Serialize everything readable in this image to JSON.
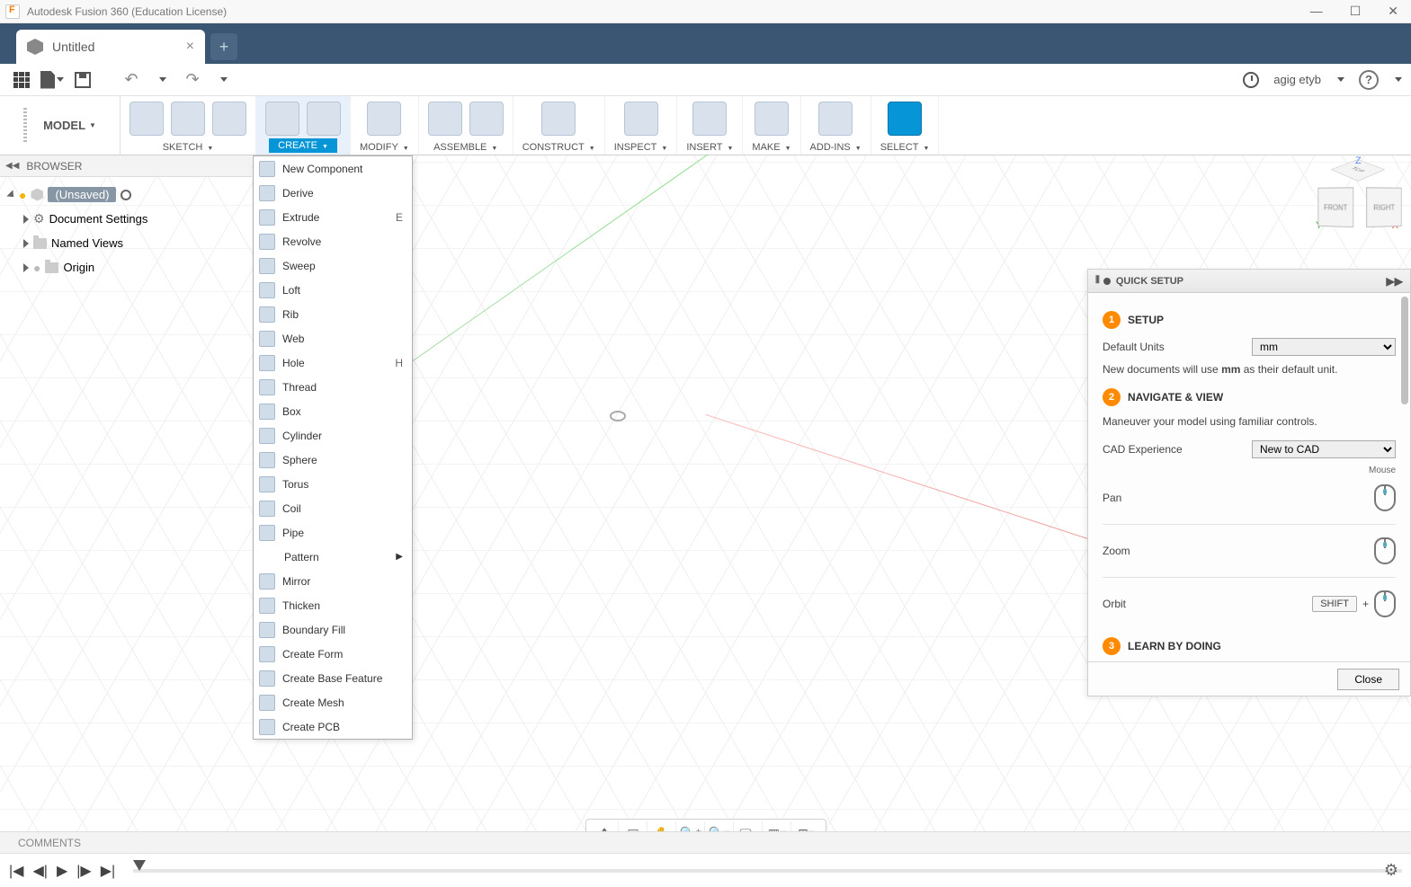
{
  "titlebar": {
    "title": "Autodesk Fusion 360 (Education License)"
  },
  "tab": {
    "name": "Untitled"
  },
  "qat": {
    "user": "agig etyb"
  },
  "workspace": {
    "label": "MODEL"
  },
  "ribbon": [
    {
      "label": "SKETCH",
      "icons": 3
    },
    {
      "label": "CREATE",
      "icons": 2,
      "active": true
    },
    {
      "label": "MODIFY",
      "icons": 1
    },
    {
      "label": "ASSEMBLE",
      "icons": 2
    },
    {
      "label": "CONSTRUCT",
      "icons": 1
    },
    {
      "label": "INSPECT",
      "icons": 1
    },
    {
      "label": "INSERT",
      "icons": 1
    },
    {
      "label": "MAKE",
      "icons": 1
    },
    {
      "label": "ADD-INS",
      "icons": 1
    },
    {
      "label": "SELECT",
      "icons": 1,
      "selected": true
    }
  ],
  "browser": {
    "title": "BROWSER",
    "root": "(Unsaved)",
    "items": [
      "Document Settings",
      "Named Views",
      "Origin"
    ]
  },
  "create_menu": [
    {
      "label": "New Component"
    },
    {
      "label": "Derive"
    },
    {
      "label": "Extrude",
      "shortcut": "E"
    },
    {
      "label": "Revolve"
    },
    {
      "label": "Sweep"
    },
    {
      "label": "Loft"
    },
    {
      "label": "Rib"
    },
    {
      "label": "Web"
    },
    {
      "label": "Hole",
      "shortcut": "H"
    },
    {
      "label": "Thread"
    },
    {
      "label": "Box"
    },
    {
      "label": "Cylinder"
    },
    {
      "label": "Sphere"
    },
    {
      "label": "Torus"
    },
    {
      "label": "Coil"
    },
    {
      "label": "Pipe"
    },
    {
      "label": "Pattern",
      "submenu": true,
      "indent": true
    },
    {
      "label": "Mirror"
    },
    {
      "label": "Thicken"
    },
    {
      "label": "Boundary Fill"
    },
    {
      "label": "Create Form"
    },
    {
      "label": "Create Base Feature"
    },
    {
      "label": "Create Mesh"
    },
    {
      "label": "Create PCB"
    }
  ],
  "viewcube": {
    "top": "TOP",
    "front": "FRONT",
    "right": "RIGHT",
    "z": "Z",
    "y": "Y",
    "x": "X"
  },
  "quicksetup": {
    "title": "QUICK SETUP",
    "s1": {
      "title": "SETUP",
      "units_label": "Default Units",
      "units_value": "mm",
      "note_pre": "New documents will use ",
      "note_b": "mm",
      "note_post": " as their default unit."
    },
    "s2": {
      "title": "NAVIGATE & VIEW",
      "note": "Maneuver your model using familiar controls.",
      "exp_label": "CAD Experience",
      "exp_value": "New to CAD",
      "mouse": "Mouse",
      "pan": "Pan",
      "zoom": "Zoom",
      "orbit": "Orbit",
      "shift": "SHIFT"
    },
    "s3": {
      "title": "LEARN BY DOING"
    },
    "close": "Close"
  },
  "comments": {
    "label": "COMMENTS"
  }
}
